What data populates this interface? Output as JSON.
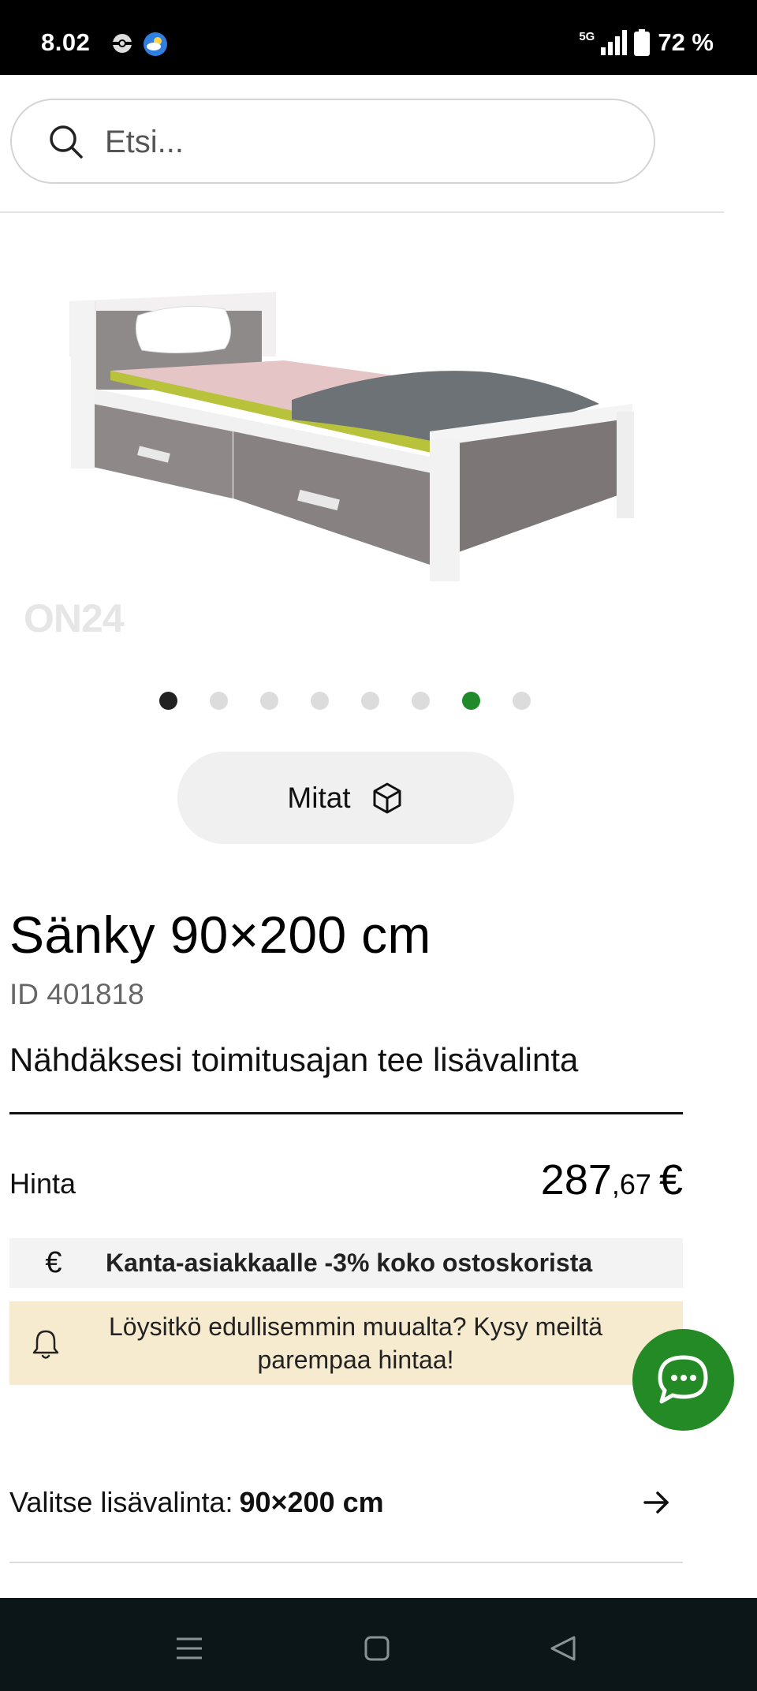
{
  "status_bar": {
    "time": "8.02",
    "network_label": "5G",
    "battery": "72 %",
    "icons": [
      "pokeball-icon",
      "weather-icon",
      "signal-icon",
      "battery-icon"
    ]
  },
  "search": {
    "placeholder": "Etsi..."
  },
  "product": {
    "image_alt": "bed-product-photo",
    "watermark": "ON24",
    "carousel": {
      "total": 8,
      "current_index": 1,
      "accent_index": 7
    },
    "dimensions_button": "Mitat",
    "title": "Sänky 90×200 cm",
    "id_label": "ID 401818",
    "delivery_text": "Nähdäksesi toimitusajan tee lisävalinta",
    "price_label": "Hinta",
    "price_integer": "287",
    "price_decimal": ",67",
    "price_currency": "€",
    "loyalty_text": "Kanta-asiakkaalle -3% koko ostoskorista",
    "price_match_line1": "Löysitkö edullisemmin muualta? Kysy meiltä",
    "price_match_line2": "parempaa hintaa!",
    "variant_prefix": "Valitse lisävalinta:",
    "variant_value": "90×200 cm"
  },
  "colors": {
    "accent_green": "#1f8a2a",
    "chat_green": "#238a26",
    "price_match_bg": "#f7ebcf",
    "loyalty_bg": "#f3f3f3",
    "nav_bg": "#0c1518"
  }
}
